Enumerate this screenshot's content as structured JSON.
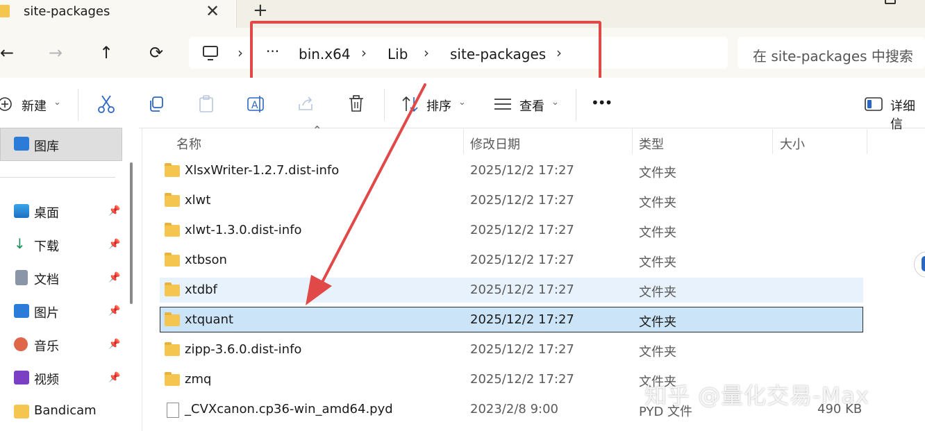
{
  "tab": {
    "title": "site-packages",
    "close": "✕",
    "new_tab": "+"
  },
  "window": {
    "minimize": "—"
  },
  "nav": {
    "back": "←",
    "forward": "→",
    "up": "↑",
    "refresh": "⟳"
  },
  "address": {
    "computer_icon": "computer-icon",
    "sep": "›",
    "overflow": "···",
    "crumbs": [
      "bin.x64",
      "Lib",
      "site-packages"
    ]
  },
  "search": {
    "placeholder": "在 site-packages 中搜索"
  },
  "toolbar": {
    "new_label": "新建",
    "sort_label": "排序",
    "view_label": "查看",
    "more": "•••",
    "details_label": "详细信"
  },
  "sidebar": {
    "gallery": "图库",
    "items": [
      {
        "label": "桌面",
        "icon": "desktop-icon",
        "pinned": true
      },
      {
        "label": "下载",
        "icon": "download-icon",
        "pinned": true
      },
      {
        "label": "文档",
        "icon": "document-icon",
        "pinned": true
      },
      {
        "label": "图片",
        "icon": "pictures-icon",
        "pinned": true
      },
      {
        "label": "音乐",
        "icon": "music-icon",
        "pinned": true
      },
      {
        "label": "视频",
        "icon": "video-icon",
        "pinned": true
      },
      {
        "label": "Bandicam",
        "icon": "folder-icon",
        "pinned": false
      }
    ]
  },
  "columns": {
    "name": "名称",
    "date": "修改日期",
    "type": "类型",
    "size": "大小"
  },
  "files": [
    {
      "name": "XlsxWriter-1.2.7.dist-info",
      "date": "2025/12/2 17:27",
      "type": "文件夹",
      "size": ""
    },
    {
      "name": "xlwt",
      "date": "2025/12/2 17:27",
      "type": "文件夹",
      "size": ""
    },
    {
      "name": "xlwt-1.3.0.dist-info",
      "date": "2025/12/2 17:27",
      "type": "文件夹",
      "size": ""
    },
    {
      "name": "xtbson",
      "date": "2025/12/2 17:27",
      "type": "文件夹",
      "size": ""
    },
    {
      "name": "xtdbf",
      "date": "2025/12/2 17:27",
      "type": "文件夹",
      "size": ""
    },
    {
      "name": "xtquant",
      "date": "2025/12/2 17:27",
      "type": "文件夹",
      "size": ""
    },
    {
      "name": "zipp-3.6.0.dist-info",
      "date": "2025/12/2 17:27",
      "type": "文件夹",
      "size": ""
    },
    {
      "name": "zmq",
      "date": "2025/12/2 17:27",
      "type": "文件夹",
      "size": ""
    },
    {
      "name": "_CVXcanon.cp36-win_amd64.pyd",
      "date": "2023/2/8 9:00",
      "type": "PYD 文件",
      "size": "490 KB"
    }
  ],
  "watermark": "知乎 @量化交易-Max",
  "colors": {
    "annotation_red": "#e14848",
    "selection_blue": "#cce4f7",
    "folder_yellow": "#f4c64f"
  }
}
